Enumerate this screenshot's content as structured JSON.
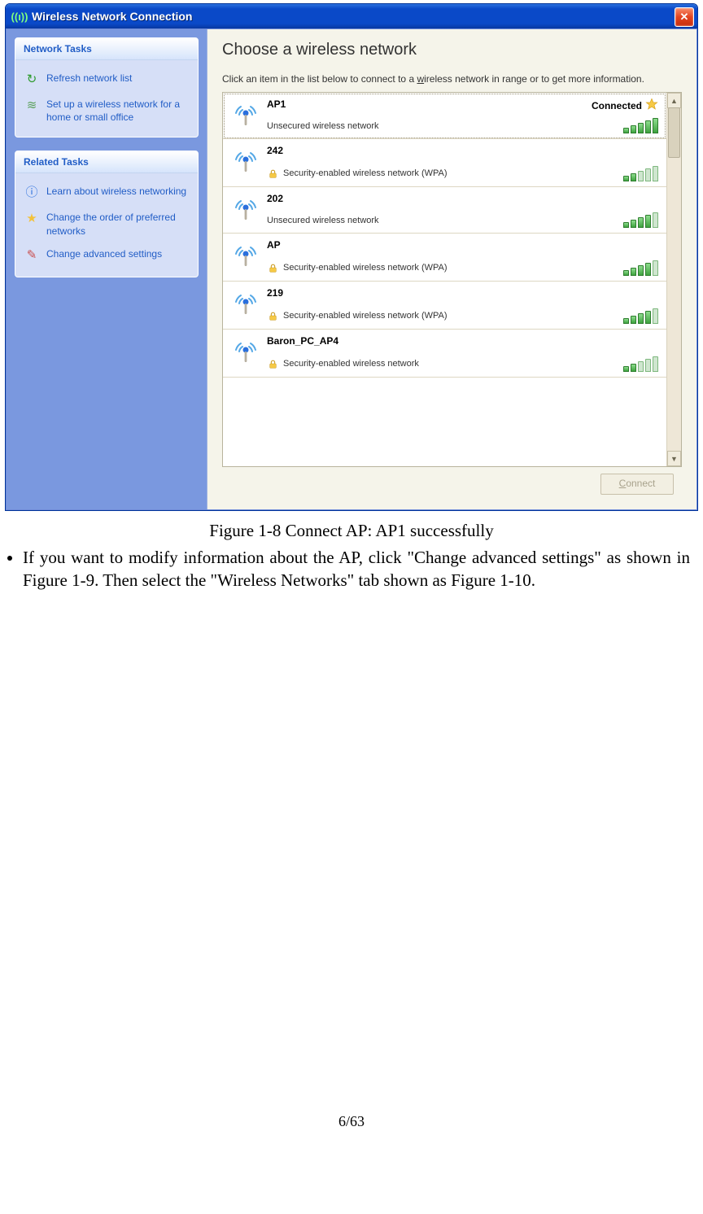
{
  "window": {
    "title": "Wireless Network Connection",
    "icon_name": "wireless-icon"
  },
  "sidebar": {
    "groups": [
      {
        "title": "Network Tasks",
        "items": [
          {
            "icon": "refresh-icon",
            "glyph": "↻",
            "color": "#2e9b2e",
            "label": "Refresh network list"
          },
          {
            "icon": "wireless-setup-icon",
            "glyph": "≋",
            "color": "#5aa05a",
            "label": "Set up a wireless network for a home or small office"
          }
        ]
      },
      {
        "title": "Related Tasks",
        "items": [
          {
            "icon": "info-icon",
            "glyph": "ⓘ",
            "color": "#2a6fdd",
            "label": "Learn about wireless networking"
          },
          {
            "icon": "star-icon",
            "glyph": "★",
            "color": "#f3c23b",
            "label": "Change the order of preferred networks"
          },
          {
            "icon": "settings-icon",
            "glyph": "✎",
            "color": "#c94f4f",
            "label": "Change advanced settings"
          }
        ]
      }
    ]
  },
  "main": {
    "heading": "Choose a wireless network",
    "instruction_pre": "Click an item in the list below to connect to a ",
    "instruction_u": "w",
    "instruction_post": "ireless network in range or to get more information.",
    "connect_btn_u": "C",
    "connect_btn_rest": "onnect"
  },
  "networks": [
    {
      "name": "AP1",
      "secured": false,
      "desc": "Unsecured wireless network",
      "status": "Connected",
      "star": true,
      "strength": 5,
      "selected": true
    },
    {
      "name": "242",
      "secured": true,
      "desc": "Security-enabled wireless network (WPA)",
      "status": "",
      "star": false,
      "strength": 2,
      "selected": false
    },
    {
      "name": "202",
      "secured": false,
      "desc": "Unsecured wireless network",
      "status": "",
      "star": false,
      "strength": 4,
      "selected": false
    },
    {
      "name": "AP",
      "secured": true,
      "desc": "Security-enabled wireless network (WPA)",
      "status": "",
      "star": false,
      "strength": 4,
      "selected": false
    },
    {
      "name": "219",
      "secured": true,
      "desc": "Security-enabled wireless network (WPA)",
      "status": "",
      "star": false,
      "strength": 4,
      "selected": false
    },
    {
      "name": "Baron_PC_AP4",
      "secured": true,
      "desc": "Security-enabled wireless network",
      "status": "",
      "star": false,
      "strength": 2,
      "selected": false
    }
  ],
  "doc": {
    "caption": "Figure 1-8 Connect AP: AP1 successfully",
    "bullet": "If you want to modify information about the AP, click \"Change advanced settings\" as shown in Figure 1-9. Then select the \"Wireless Networks\" tab shown as Figure 1-10.",
    "pagenum": "6/63"
  }
}
